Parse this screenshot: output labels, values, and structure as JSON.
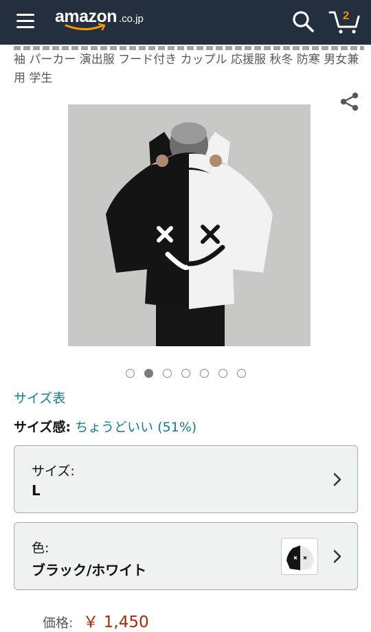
{
  "header": {
    "logo_word": "amazon",
    "logo_tld": ".co.jp",
    "cart_count": "2"
  },
  "product": {
    "title_partial": "袖 パーカー 演出服 フード付き カップル 応援服 秋冬 防寒 男女兼用 学生",
    "image_dots": 7,
    "active_dot": 1
  },
  "size_chart_link": "サイズ表",
  "fit": {
    "label": "サイズ感:",
    "value": "ちょうどいい (51%)"
  },
  "size_selector": {
    "caption": "サイズ:",
    "value": "L"
  },
  "color_selector": {
    "caption": "色:",
    "value": "ブラック/ホワイト"
  },
  "price": {
    "label": "価格:",
    "value": "￥ 1,450"
  },
  "colors": {
    "header_bg": "#232f3e",
    "link": "#0f7b95",
    "price": "#b12704",
    "cart_count": "#f08804"
  }
}
